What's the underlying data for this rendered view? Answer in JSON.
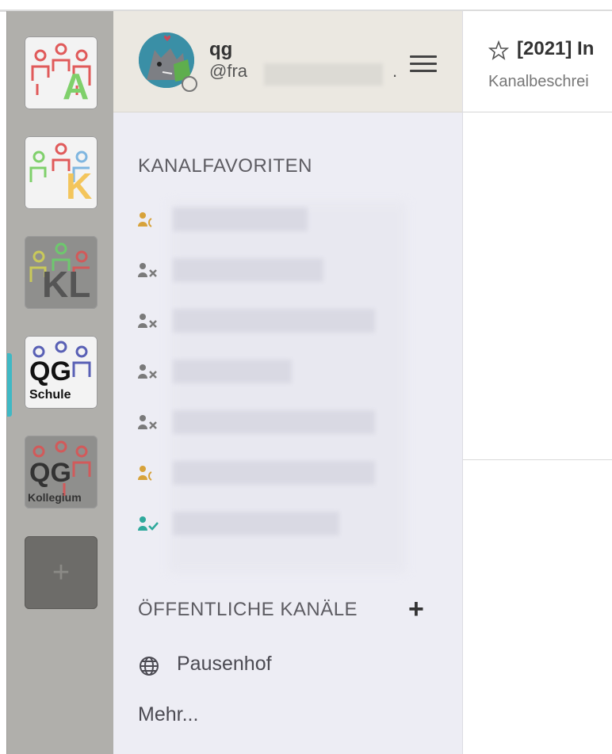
{
  "teams": [
    {
      "name": "A",
      "letter": "A",
      "accent": "#7fd06b",
      "people_color": "#e05a5a"
    },
    {
      "name": "K",
      "letter": "K",
      "accent": "#f3c55b",
      "people_color": "#7fb6e0"
    },
    {
      "name": "KL",
      "letter": "KL",
      "accent": "#555555",
      "people_color": "#c9c95a"
    },
    {
      "name": "QG Schule",
      "letter": "QG",
      "subtitle": "Schule",
      "accent": "#111111",
      "people_color": "#5960b5"
    },
    {
      "name": "QG Kollegium",
      "letter": "QG",
      "subtitle": "Kollegium",
      "accent": "#222222",
      "people_color": "#d25a5a"
    }
  ],
  "add_team_label": "+",
  "user": {
    "display_name": "qg",
    "handle_prefix": "@fra",
    "handle_suffix": "."
  },
  "sections": {
    "favorites_title": "KANALFAVORITEN",
    "public_title": "ÖFFENTLICHE KANÄLE",
    "public_add": "+"
  },
  "favorites": [
    {
      "icon": "group-away-icon",
      "color": "#d7a23a"
    },
    {
      "icon": "group-offline-icon",
      "color": "#7a7a7a"
    },
    {
      "icon": "group-offline-icon",
      "color": "#7a7a7a"
    },
    {
      "icon": "group-offline-icon",
      "color": "#7a7a7a"
    },
    {
      "icon": "group-offline-icon",
      "color": "#7a7a7a"
    },
    {
      "icon": "group-away-icon",
      "color": "#d7a23a"
    },
    {
      "icon": "group-online-icon",
      "color": "#2fa99c"
    }
  ],
  "public_channels": [
    {
      "label": "Pausenhof",
      "icon": "globe-icon"
    }
  ],
  "more_label": "Mehr...",
  "channel": {
    "title": "[2021] In",
    "description": "Kanalbeschrei"
  },
  "colors": {
    "team_active": "#3fb9c5",
    "sidebar_bg": "#ededf4",
    "header_bg": "#ebe8e1"
  }
}
